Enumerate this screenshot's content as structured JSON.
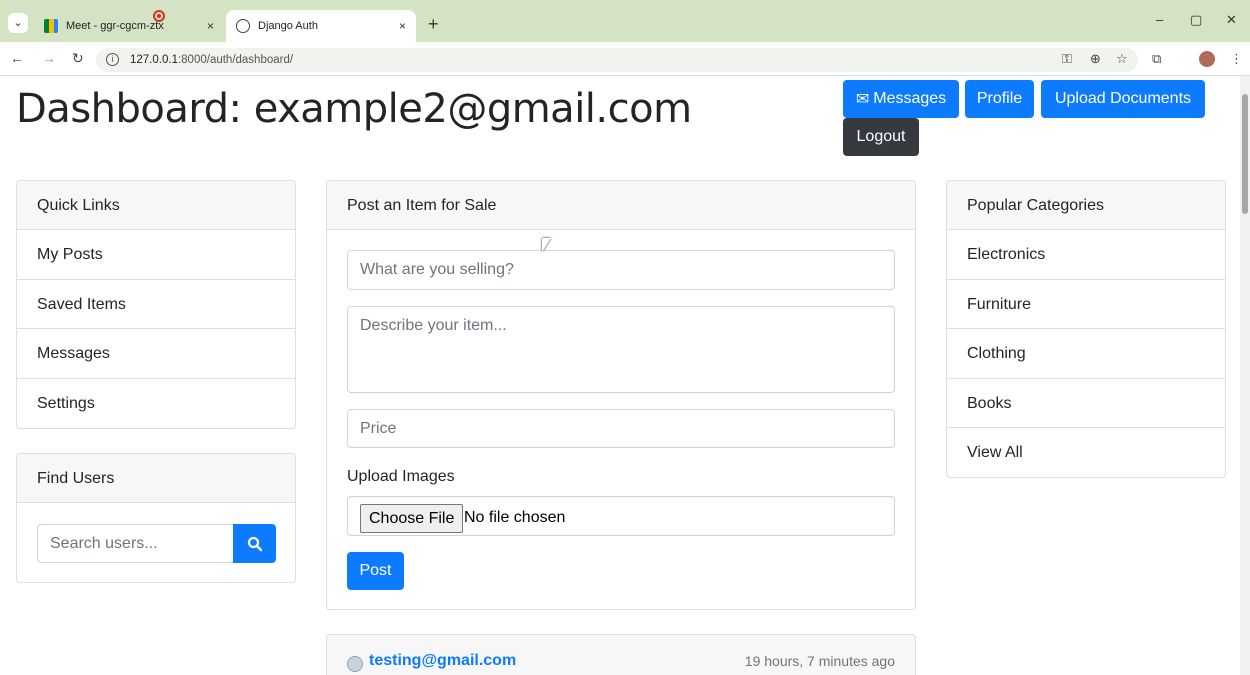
{
  "browser": {
    "tabs": [
      {
        "title": "Meet - ggr-cgcm-ztx",
        "icon": "google-meet-icon",
        "close": "×"
      },
      {
        "title": "Django Auth",
        "icon": "globe-icon",
        "close": "×"
      }
    ],
    "new_tab": "+",
    "url_host": "127.0.0.1",
    "url_path": ":8000/auth/dashboard/",
    "window_controls": {
      "minimize": "–",
      "maximize": "▢",
      "close": "✕"
    }
  },
  "header": {
    "title": "Dashboard: example2@gmail.com",
    "buttons": {
      "messages": "Messages",
      "profile": "Profile",
      "upload": "Upload Documents",
      "logout": "Logout"
    }
  },
  "quick_links": {
    "title": "Quick Links",
    "items": [
      "My Posts",
      "Saved Items",
      "Messages",
      "Settings"
    ]
  },
  "find_users": {
    "title": "Find Users",
    "placeholder": "Search users..."
  },
  "post_form": {
    "title": "Post an Item for Sale",
    "title_placeholder": "What are you selling?",
    "description_placeholder": "Describe your item...",
    "price_placeholder": "Price",
    "upload_label": "Upload Images",
    "choose_file": "Choose File",
    "no_file": "No file chosen",
    "submit": "Post"
  },
  "categories": {
    "title": "Popular Categories",
    "items": [
      "Electronics",
      "Furniture",
      "Clothing",
      "Books",
      "View All"
    ]
  },
  "feed": {
    "author": "testing@gmail.com",
    "time": "19 hours, 7 minutes ago"
  },
  "colors": {
    "primary": "#0d7bff",
    "dark": "#343a40",
    "tabstrip": "#d3e3c4"
  }
}
